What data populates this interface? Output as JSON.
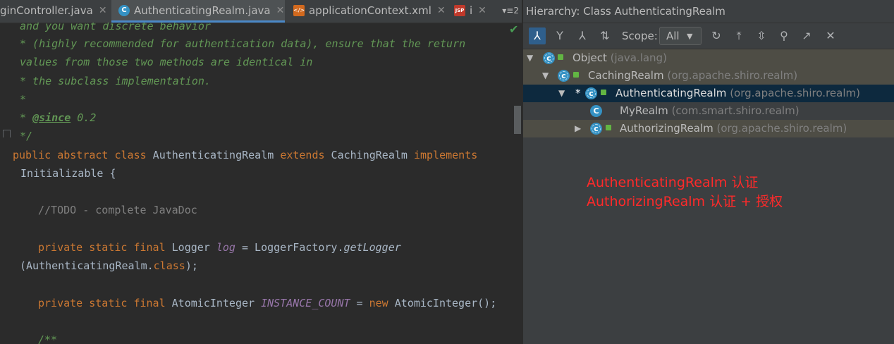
{
  "editor": {
    "tabs": [
      {
        "label": "ginController.java",
        "close": "✕"
      },
      {
        "label": "AuthenticatingRealm.java",
        "close": "✕"
      },
      {
        "label": "applicationContext.xml",
        "close": "✕"
      },
      {
        "label": "i",
        "close": "✕"
      }
    ],
    "tabs_overflow": "▾≡2",
    "code_lines": [
      "and you want discrete behavior",
      "* (highly recommended for authentication data), ensure that the return",
      "values from those two methods are identical in",
      "* the subclass implementation.",
      "*",
      "* ",
      "@since",
      " 0.2",
      "*/",
      "public abstract class",
      " AuthenticatingRealm ",
      "extends",
      " CachingRealm ",
      "implements",
      " Initializable {",
      "//TODO - complete JavaDoc",
      "private static final",
      " Logger ",
      "log",
      " = LoggerFactory.",
      "getLogger",
      "(AuthenticatingRealm.",
      "class",
      ");",
      "private static final",
      " AtomicInteger ",
      "INSTANCE_COUNT",
      " = ",
      "new",
      " AtomicInteger();",
      "/**"
    ]
  },
  "hierarchy": {
    "title": "Hierarchy:  Class AuthenticatingRealm",
    "scope_label": "Scope:",
    "scope_value": "All",
    "toolbar_icons": [
      "subtypes-hierarchy-icon",
      "supertypes-hierarchy-icon",
      "class-hierarchy-icon",
      "sort-alphabetically-icon",
      "refresh-icon",
      "export-icon",
      "expand-all-icon",
      "pin-icon",
      "autoscroll-icon",
      "close-icon"
    ],
    "tree": [
      {
        "name": "Object",
        "pkg": "(java.lang)",
        "expanded": true
      },
      {
        "name": "CachingRealm",
        "pkg": "(org.apache.shiro.realm)",
        "expanded": true
      },
      {
        "name": "AuthenticatingRealm",
        "pkg": "(org.apache.shiro.realm)",
        "marker": "*",
        "expanded": true
      },
      {
        "name": "MyRealm",
        "pkg": "(com.smart.shiro.realm)"
      },
      {
        "name": "AuthorizingRealm",
        "pkg": "(org.apache.shiro.realm)",
        "expanded": false
      }
    ]
  },
  "annotations": {
    "line1": "AuthenticatingRealm 认证",
    "line2": "AuthorizingRealm 认证 + 授权"
  },
  "colors": {
    "keyword": "#cc7832",
    "comment": "#629755",
    "field": "#9876aa",
    "note": "#ff2a2a",
    "selection": "#0d293e"
  }
}
